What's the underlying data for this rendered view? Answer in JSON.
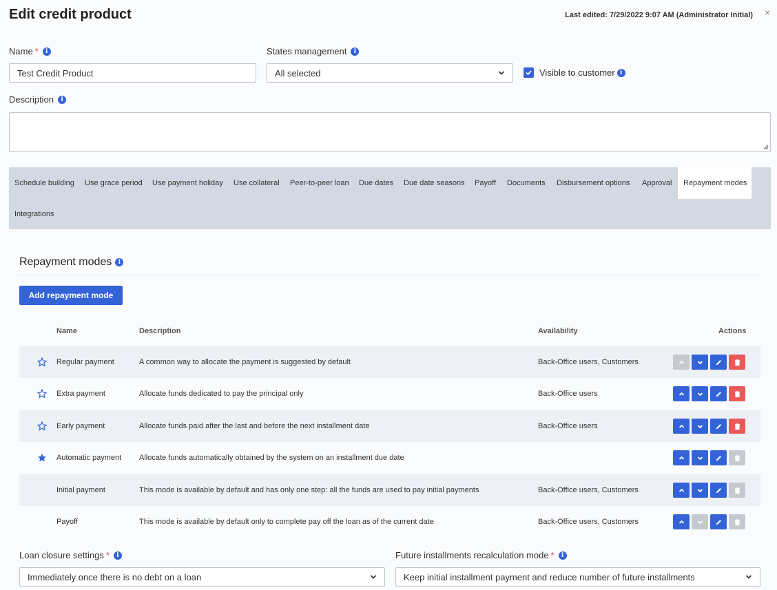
{
  "header": {
    "title": "Edit credit product",
    "last_edited": "Last edited: 7/29/2022 9:07 AM (Administrator Initial)",
    "close_label": "×"
  },
  "form": {
    "name_label": "Name",
    "name_value": "Test Credit Product",
    "states_label": "States management",
    "states_value": "All selected",
    "visible_label": "Visible to customer",
    "visible_checked": true,
    "description_label": "Description",
    "description_value": ""
  },
  "tabs": [
    {
      "label": "Schedule building"
    },
    {
      "label": "Use grace period"
    },
    {
      "label": "Use payment holiday"
    },
    {
      "label": "Use collateral"
    },
    {
      "label": "Peer-to-peer loan"
    },
    {
      "label": "Due dates"
    },
    {
      "label": "Due date seasons"
    },
    {
      "label": "Payoff"
    },
    {
      "label": "Documents"
    },
    {
      "label": "Disbursement options"
    },
    {
      "label": "Approval"
    },
    {
      "label": "Repayment modes",
      "active": true
    },
    {
      "label": "Integrations"
    }
  ],
  "repayment": {
    "section_title": "Repayment modes",
    "add_button": "Add repayment mode",
    "columns": {
      "name": "Name",
      "description": "Description",
      "availability": "Availability",
      "actions": "Actions"
    },
    "rows": [
      {
        "star": "outline",
        "name": "Regular payment",
        "description": "A common way to allocate the payment is suggested by default",
        "availability": "Back-Office users, Customers",
        "up": "disabled",
        "down": "enabled",
        "delete": "enabled"
      },
      {
        "star": "outline",
        "name": "Extra payment",
        "description": "Allocate funds dedicated to pay the principal only",
        "availability": "Back-Office users",
        "up": "enabled",
        "down": "enabled",
        "delete": "enabled"
      },
      {
        "star": "outline",
        "name": "Early payment",
        "description": "Allocate funds paid after the last and before the next installment date",
        "availability": "Back-Office users",
        "up": "enabled",
        "down": "enabled",
        "delete": "enabled"
      },
      {
        "star": "filled",
        "name": "Automatic payment",
        "description": "Allocate funds automatically obtained by the system on an installment due date",
        "availability": "",
        "up": "enabled",
        "down": "enabled",
        "delete": "disabled"
      },
      {
        "star": "none",
        "name": "Initial payment",
        "description": "This mode is available by default and has only one step: all the funds are used to pay initial payments",
        "availability": "Back-Office users, Customers",
        "up": "enabled",
        "down": "enabled",
        "delete": "disabled"
      },
      {
        "star": "none",
        "name": "Payoff",
        "description": "This mode is available by default only to complete pay off the loan as of the current date",
        "availability": "Back-Office users, Customers",
        "up": "enabled",
        "down": "disabled",
        "delete": "disabled"
      }
    ]
  },
  "loan_closure": {
    "label": "Loan closure settings",
    "value": "Immediately once there is no debt on a loan"
  },
  "future_installments": {
    "label": "Future installments recalculation mode",
    "value": "Keep initial installment payment and reduce number of future installments"
  },
  "colors": {
    "accent": "#3463d8",
    "danger": "#e85a5a",
    "disabled": "#c5cad1",
    "tab_bar": "#d3d9e2"
  }
}
